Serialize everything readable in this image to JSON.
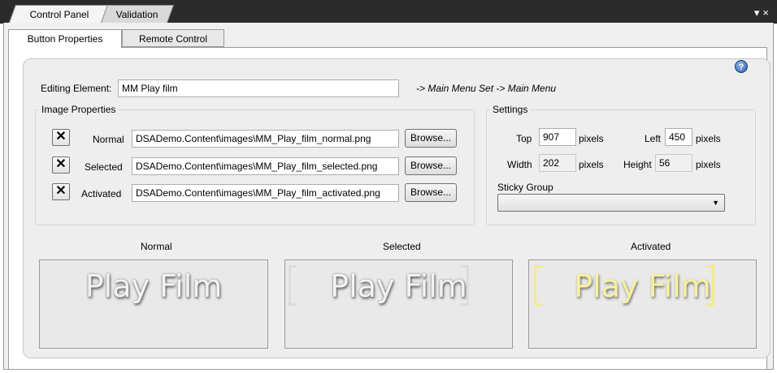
{
  "tabs": {
    "control_panel": "Control Panel",
    "validation": "Validation"
  },
  "titlebar_icons": {
    "dropdown": "▾",
    "close": "×"
  },
  "subtabs": {
    "button_properties": "Button Properties",
    "remote_control": "Remote Control"
  },
  "editing": {
    "label": "Editing Element:",
    "value": "MM Play film",
    "path": "-> Main Menu Set -> Main Menu"
  },
  "image_properties": {
    "title": "Image Properties",
    "rows": [
      {
        "label": "Normal",
        "value": "DSADemo.Content\\images\\MM_Play_film_normal.png",
        "browse": "Browse..."
      },
      {
        "label": "Selected",
        "value": "DSADemo.Content\\images\\MM_Play_film_selected.png",
        "browse": "Browse..."
      },
      {
        "label": "Activated",
        "value": "DSADemo.Content\\images\\MM_Play_film_activated.png",
        "browse": "Browse..."
      }
    ]
  },
  "settings": {
    "title": "Settings",
    "top_label": "Top",
    "top_value": "907",
    "top_unit": "pixels",
    "left_label": "Left",
    "left_value": "450",
    "left_unit": "pixels",
    "width_label": "Width",
    "width_value": "202",
    "width_unit": "pixels",
    "height_label": "Height",
    "height_value": "56",
    "height_unit": "pixels",
    "sticky_label": "Sticky Group",
    "sticky_value": ""
  },
  "previews": [
    {
      "label": "Normal",
      "text": "Play Film"
    },
    {
      "label": "Selected",
      "text": "Play Film"
    },
    {
      "label": "Activated",
      "text": "Play Film"
    }
  ],
  "colors": {
    "titlebar": "#2b2b2b",
    "activated_text": "#f7f0a0",
    "help_icon": "#2a5ea8"
  }
}
